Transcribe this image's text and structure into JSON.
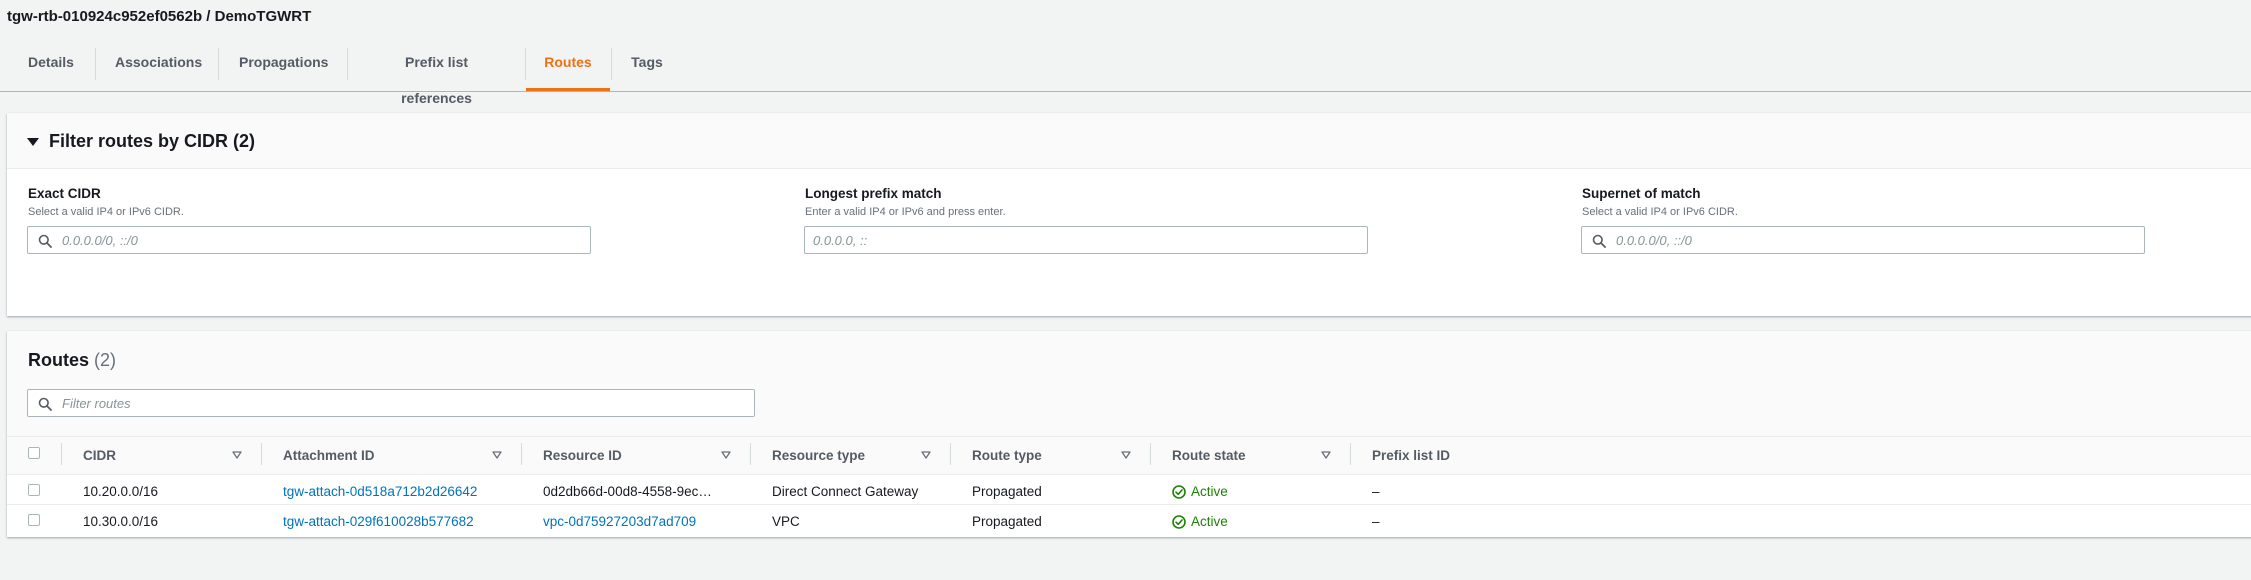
{
  "header": {
    "title": "tgw-rtb-010924c952ef0562b / DemoTGWRT"
  },
  "tabs": [
    {
      "label": "Details",
      "active": false
    },
    {
      "label": "Associations",
      "active": false
    },
    {
      "label": "Propagations",
      "active": false
    },
    {
      "label": "Prefix list references",
      "active": false
    },
    {
      "label": "Routes",
      "active": true
    },
    {
      "label": "Tags",
      "active": false
    }
  ],
  "filter": {
    "title": "Filter routes by CIDR (2)",
    "fields": [
      {
        "label": "Exact CIDR",
        "hint": "Select a valid IP4 or IPv6 CIDR.",
        "placeholder": "0.0.0.0/0, ::/0",
        "value": "",
        "icon": "search-icon"
      },
      {
        "label": "Longest prefix match",
        "hint": "Enter a valid IP4 or IPv6 and press enter.",
        "placeholder": "0.0.0.0, ::",
        "value": "",
        "icon": ""
      },
      {
        "label": "Supernet of match",
        "hint": "Select a valid IP4 or IPv6 CIDR.",
        "placeholder": "0.0.0.0/0, ::/0",
        "value": "",
        "icon": "search-icon"
      }
    ]
  },
  "routes": {
    "title": "Routes",
    "count": "(2)",
    "search_placeholder": "Filter routes",
    "columns": [
      "CIDR",
      "Attachment ID",
      "Resource ID",
      "Resource type",
      "Route type",
      "Route state",
      "Prefix list ID"
    ],
    "rows": [
      {
        "cidr": "10.20.0.0/16",
        "attachment_id": "tgw-attach-0d518a712b2d26642",
        "resource_id": "0d2db66d-00d8-4558-9ec…",
        "resource_type": "Direct Connect Gateway",
        "route_type": "Propagated",
        "route_state": "Active",
        "prefix_list_id": "–"
      },
      {
        "cidr": "10.30.0.0/16",
        "attachment_id": "tgw-attach-029f610028b577682",
        "resource_id": "vpc-0d75927203d7ad709",
        "resource_type": "VPC",
        "route_type": "Propagated",
        "route_state": "Active",
        "prefix_list_id": "–"
      }
    ]
  },
  "colors": {
    "accent": "#ec7211",
    "link": "#0073bb",
    "success": "#1d8102"
  }
}
